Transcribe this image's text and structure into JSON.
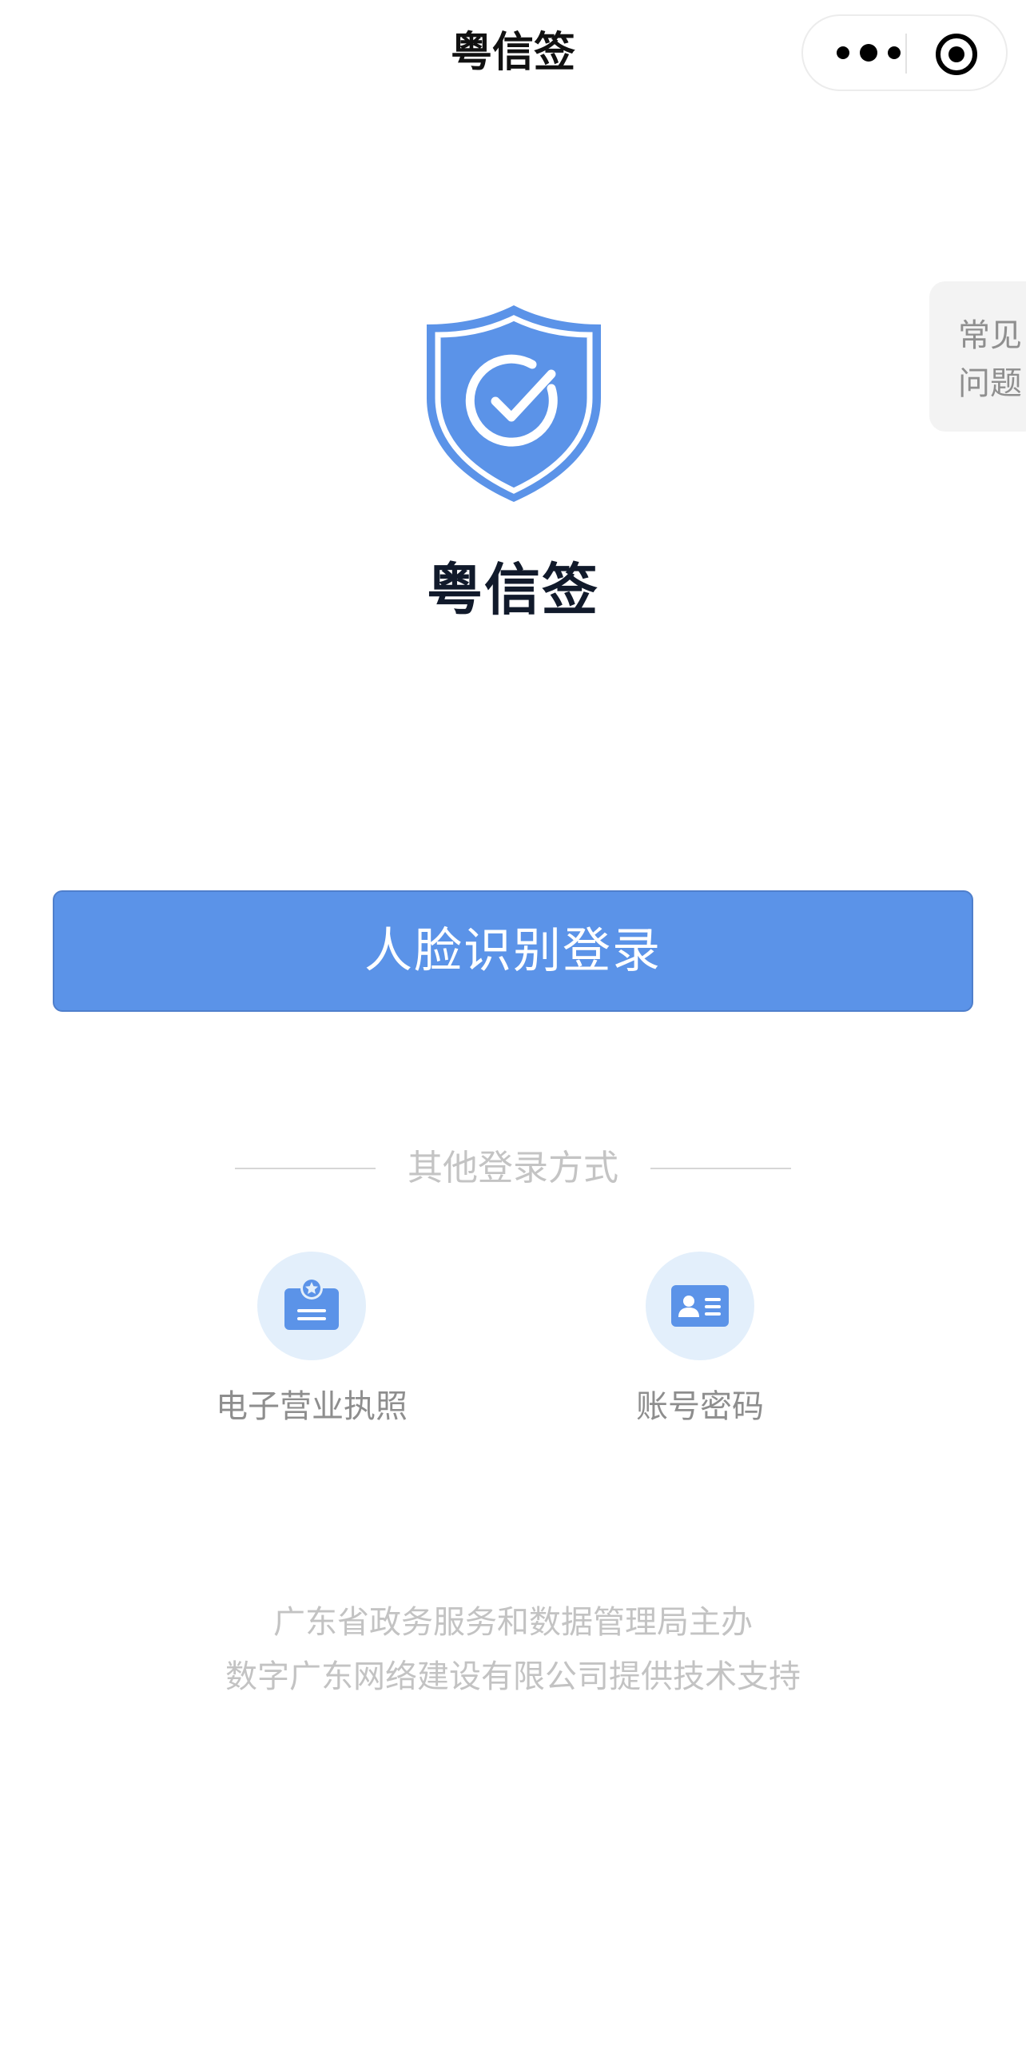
{
  "nav": {
    "title": "粤信签",
    "more_icon": "more-dots-icon",
    "close_icon": "target-circle-icon"
  },
  "faq": {
    "line1": "常见",
    "line2": "问题"
  },
  "brand": {
    "name": "粤信签",
    "logo_icon": "shield-check-icon",
    "accent": "#5b93e8"
  },
  "primary_login": {
    "label": "人脸识别登录"
  },
  "other_logins": {
    "heading": "其他登录方式",
    "options": [
      {
        "label": "电子营业执照",
        "icon": "business-license-icon"
      },
      {
        "label": "账号密码",
        "icon": "id-card-icon"
      }
    ]
  },
  "footer": {
    "line1": "广东省政务服务和数据管理局主办",
    "line2": "数字广东网络建设有限公司提供技术支持"
  }
}
